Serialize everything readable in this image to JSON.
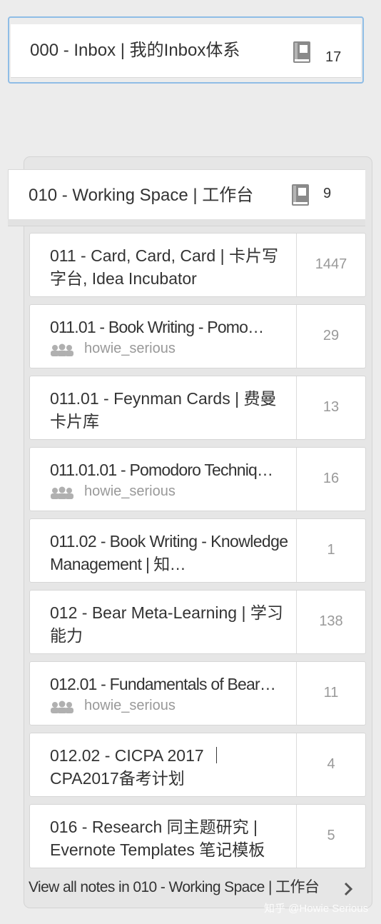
{
  "inbox": {
    "title": "000 - Inbox | 我的Inbox体系",
    "count": "17",
    "icon": "notebook-icon"
  },
  "stack": {
    "title": "010 - Working Space | 工作台",
    "count": "9",
    "icon": "notebook-icon"
  },
  "notebooks": [
    {
      "title": "011 - Card, Card, Card | 卡片写字台, Idea Incubator",
      "count": "1447"
    },
    {
      "title": "011.01 - Book Writing - Pomo…",
      "owner": "howie_serious",
      "count": "29"
    },
    {
      "title": "011.01 - Feynman Cards | 费曼卡片库",
      "count": "13"
    },
    {
      "title": "011.01.01 - Pomodoro Techniq…",
      "owner": "howie_serious",
      "count": "16"
    },
    {
      "title": "011.02 - Book Writing - Knowledge Management | 知…",
      "count": "1"
    },
    {
      "title": "012 - Bear Meta-Learning | 学习能力",
      "count": "138"
    },
    {
      "title": "012.01 - Fundamentals of Bear…",
      "owner": "howie_serious",
      "count": "11"
    },
    {
      "title": "012.02 - CICPA 2017 ｜CPA2017备考计划",
      "count": "4"
    },
    {
      "title": "016 - Research 同主题研究 | Evernote Templates 笔记模板",
      "count": "5"
    }
  ],
  "view_all": "View all notes in 010 - Working Space | 工作台",
  "watermark": "知乎 @Howie Serious",
  "colors": {
    "selected_border": "#8fbde6",
    "background": "#ececec",
    "count_text": "#999999"
  }
}
